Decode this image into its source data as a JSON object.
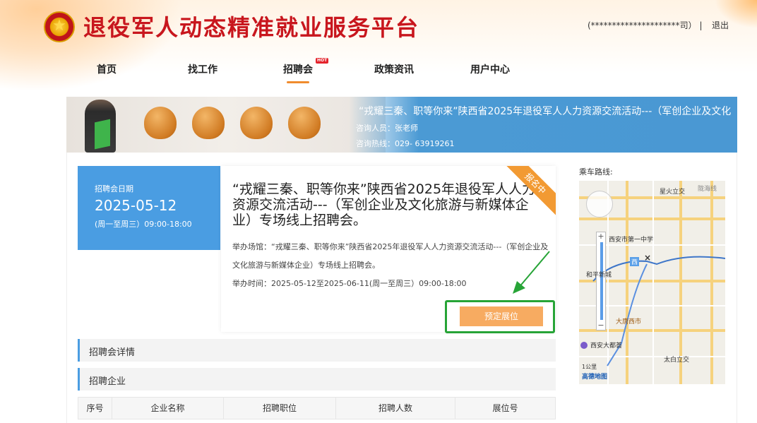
{
  "header": {
    "site_title": "退役军人动态精准就业服务平台",
    "user_info": "(*********************司） |",
    "logout_label": "退出"
  },
  "nav": {
    "items": [
      "首页",
      "找工作",
      "招聘会",
      "政策资讯",
      "用户中心"
    ],
    "active": "招聘会",
    "hot_badge": "HOT"
  },
  "banner": {
    "title": "“戎耀三秦、职等你来”陕西省2025年退役军人人力资源交流活动---（军创企业及文化",
    "contact_line": "咨询人员：张老师",
    "hotline_line": "咨询热线：029- 63919261"
  },
  "fair": {
    "date_label": "招聘会日期",
    "date": "2025-05-12",
    "date_range": "(周一至周三）09:00-18:00",
    "title": "“戎耀三秦、职等你来”陕西省2025年退役军人人力资源交流活动---（军创企业及文化旅游与新媒体企业）专场线上招聘会。",
    "venue_line": "举办场馆：“戎耀三秦、职等你来”陕西省2025年退役军人人力资源交流活动---（军创企业及文化旅游与新媒体企业）专场线上招聘会。",
    "time_line": "举办时间：2025-05-12至2025-06-11(周一至周三）09:00-18:00",
    "ribbon": "报名中",
    "book_button": "预定展位"
  },
  "sections": {
    "details": "招聘会详情",
    "companies": "招聘企业"
  },
  "table": {
    "columns": [
      "序号",
      "企业名称",
      "招聘职位",
      "招聘人数",
      "展位号"
    ]
  },
  "map": {
    "route_label": "乘车路线:",
    "labels": [
      "星火立交",
      "陇海线",
      "西安市第一中学",
      "西",
      "和平新城",
      "大唐西市",
      "西安大都荟",
      "太白立交",
      "1公里",
      "高德地图"
    ]
  },
  "colors": {
    "brand_red": "#c8161d",
    "accent_blue": "#4a9de2",
    "accent_orange": "#f29a33",
    "highlight_green": "#27a437"
  }
}
